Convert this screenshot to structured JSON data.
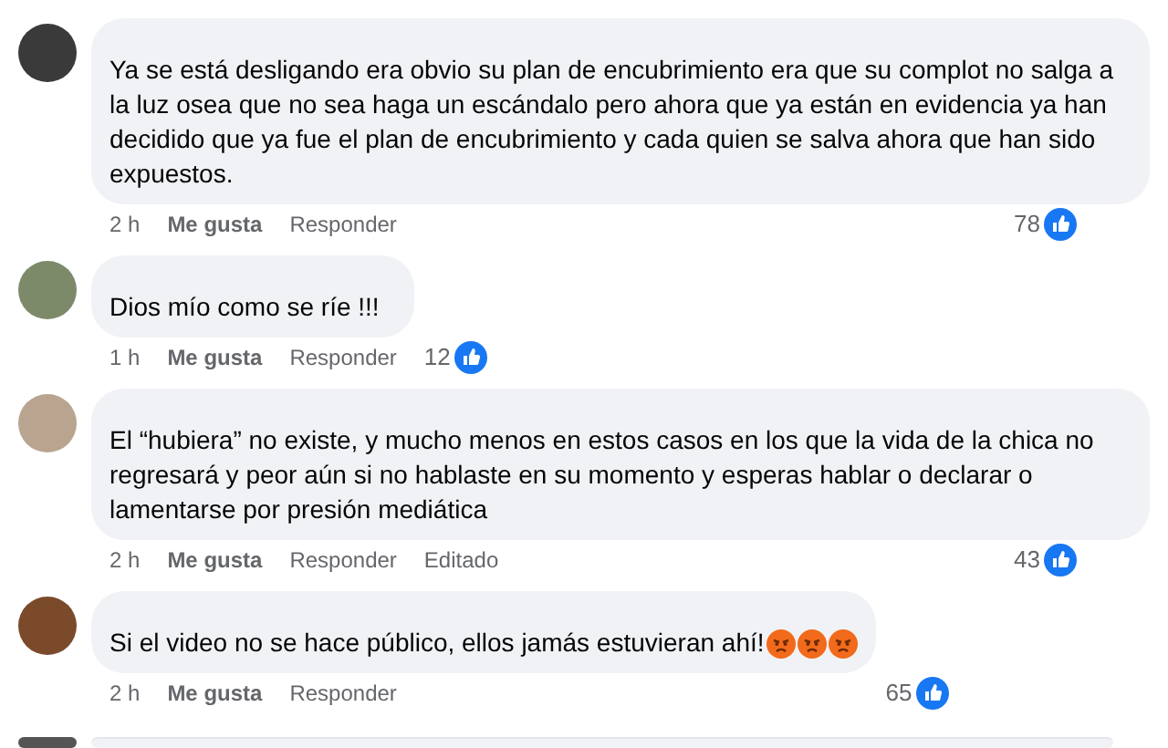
{
  "comments": [
    {
      "text": "Ya se está desligando era obvio su plan de encubrimiento era que su complot no salga a la luz osea que no sea haga un escándalo pero ahora que ya están en evidencia ya han decidido que ya fue el plan de encubrimiento y cada quien se salva ahora que han sido expuestos.",
      "time": "2 h",
      "like_label": "Me gusta",
      "reply_label": "Responder",
      "likes": "78"
    },
    {
      "text": "Dios mío como se ríe !!!",
      "time": "1 h",
      "like_label": "Me gusta",
      "reply_label": "Responder",
      "likes": "12"
    },
    {
      "text": "El “hubiera” no existe, y mucho menos en estos casos en los que la vida de la chica no regresará y peor aún si no hablaste en su momento y esperas hablar o declarar o lamentarse por presión mediática",
      "time": "2 h",
      "like_label": "Me gusta",
      "reply_label": "Responder",
      "edited_label": "Editado",
      "likes": "43"
    },
    {
      "text": "Si el video no se hace público, ellos jamás estuvieran ahí!",
      "emojis": [
        {
          "kind": "angry"
        },
        {
          "kind": "angry"
        },
        {
          "kind": "angry"
        }
      ],
      "time": "2 h",
      "like_label": "Me gusta",
      "reply_label": "Responder",
      "likes": "65"
    }
  ]
}
